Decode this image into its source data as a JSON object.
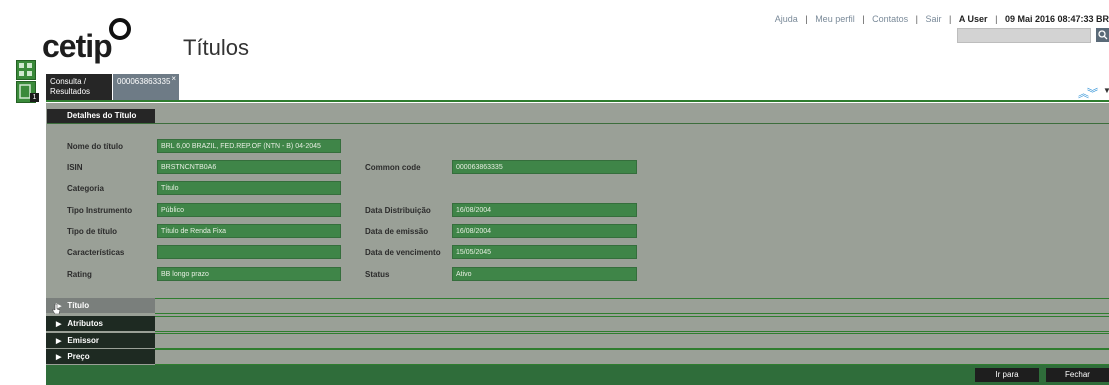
{
  "header": {
    "logo_text": "cetip",
    "page_title": "Títulos",
    "links": [
      "Ajuda",
      "Meu perfil",
      "Contatos",
      "Sair"
    ],
    "user": "A User",
    "datetime": "09 Mai 2016 08:47:33 BR"
  },
  "side": {
    "badge": "1"
  },
  "tabs": [
    {
      "label": "Consulta / Resultados"
    },
    {
      "label": "000063863335",
      "close": "×"
    }
  ],
  "details": {
    "tab_label": "Detalhes do Título",
    "fields": {
      "nome_label": "Nome do título",
      "nome_value": "BRL 6,00 BRAZIL, FED.REP.OF (NTN - B) 04-2045",
      "isin_label": "ISIN",
      "isin_value": "BRSTNCNTB0A6",
      "common_label": "Common code",
      "common_value": "000063863335",
      "categoria_label": "Categoria",
      "categoria_value": "Título",
      "tipo_instr_label": "Tipo Instrumento",
      "tipo_instr_value": "Público",
      "distrib_label": "Data Distribuição",
      "distrib_value": "16/08/2004",
      "tipo_titulo_label": "Tipo de título",
      "tipo_titulo_value": "Título de Renda Fixa",
      "emissao_label": "Data de emissão",
      "emissao_value": "16/08/2004",
      "caract_label": "Características",
      "caract_value": "",
      "venc_label": "Data de vencimento",
      "venc_value": "15/05/2045",
      "rating_label": "Rating",
      "rating_value": "BB longo prazo",
      "status_label": "Status",
      "status_value": "Ativo"
    }
  },
  "sections": [
    "Título",
    "Atributos",
    "Emissor",
    "Preço"
  ],
  "footer": {
    "goto_label": "Ir para",
    "close_label": "Fechar"
  },
  "colors": {
    "field_green": "#3f8548",
    "panel_gray": "#9aa097",
    "accent_green": "#2f7d2f"
  }
}
